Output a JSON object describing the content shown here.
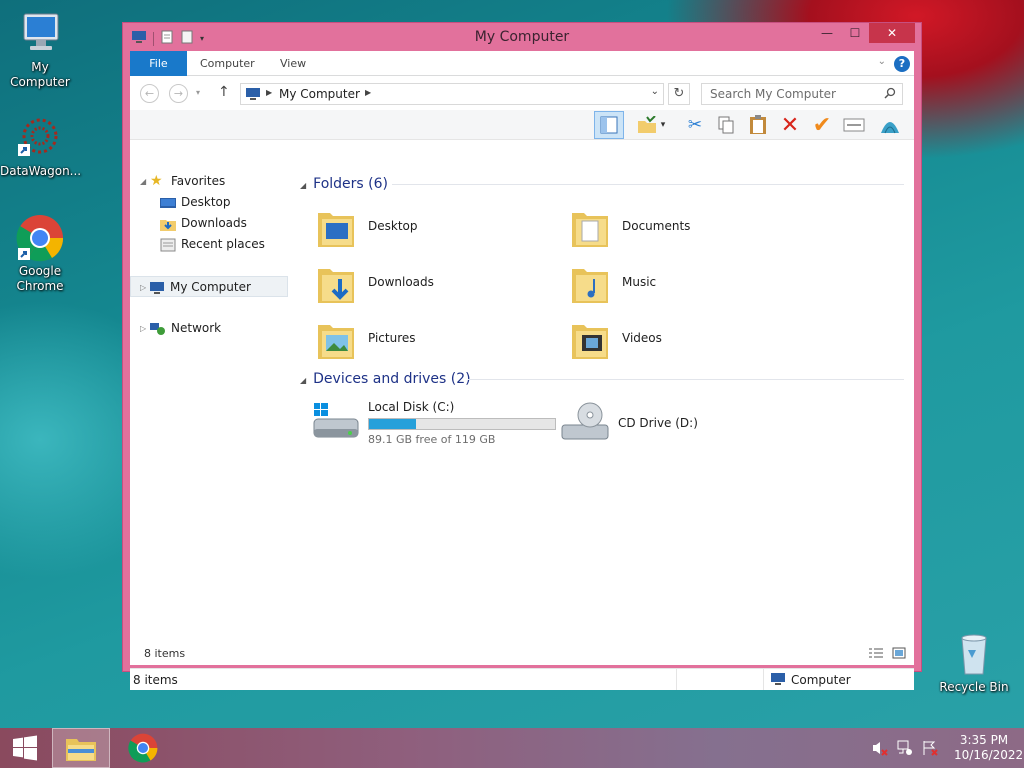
{
  "desktop": {
    "icons": [
      {
        "label": "My Computer",
        "icon": "computer-icon"
      },
      {
        "label": "DataWagon...",
        "icon": "datawagon-icon"
      },
      {
        "label": "Google Chrome",
        "icon": "chrome-icon"
      },
      {
        "label": "Recycle Bin",
        "icon": "recycle-bin-icon"
      }
    ]
  },
  "window": {
    "title": "My Computer",
    "controls": {
      "minimize": "—",
      "maximize": "☐",
      "close": "✕"
    }
  },
  "ribbon": {
    "tabs": [
      "File",
      "Computer",
      "View"
    ],
    "help": "?"
  },
  "navbar": {
    "address": "My Computer",
    "search_placeholder": "Search My Computer"
  },
  "navpane": {
    "favorites": "Favorites",
    "favorite_items": [
      "Desktop",
      "Downloads",
      "Recent places"
    ],
    "my_computer": "My Computer",
    "network": "Network"
  },
  "content": {
    "folders_header": "Folders (6)",
    "folders": [
      "Desktop",
      "Documents",
      "Downloads",
      "Music",
      "Pictures",
      "Videos"
    ],
    "devices_header": "Devices and drives (2)",
    "drives": [
      {
        "name": "Local Disk (C:)",
        "free": "89.1 GB free of 119 GB",
        "used_fraction": 0.25
      },
      {
        "name": "CD Drive (D:)"
      }
    ]
  },
  "status": {
    "items_top": "8 items",
    "items": "8 items",
    "location": "Computer"
  },
  "taskbar": {
    "time": "3:35 PM",
    "date": "10/16/2022"
  },
  "colors": {
    "window_frame": "#e2719c",
    "accent": "#1979ca",
    "header_text": "#1e3287"
  }
}
